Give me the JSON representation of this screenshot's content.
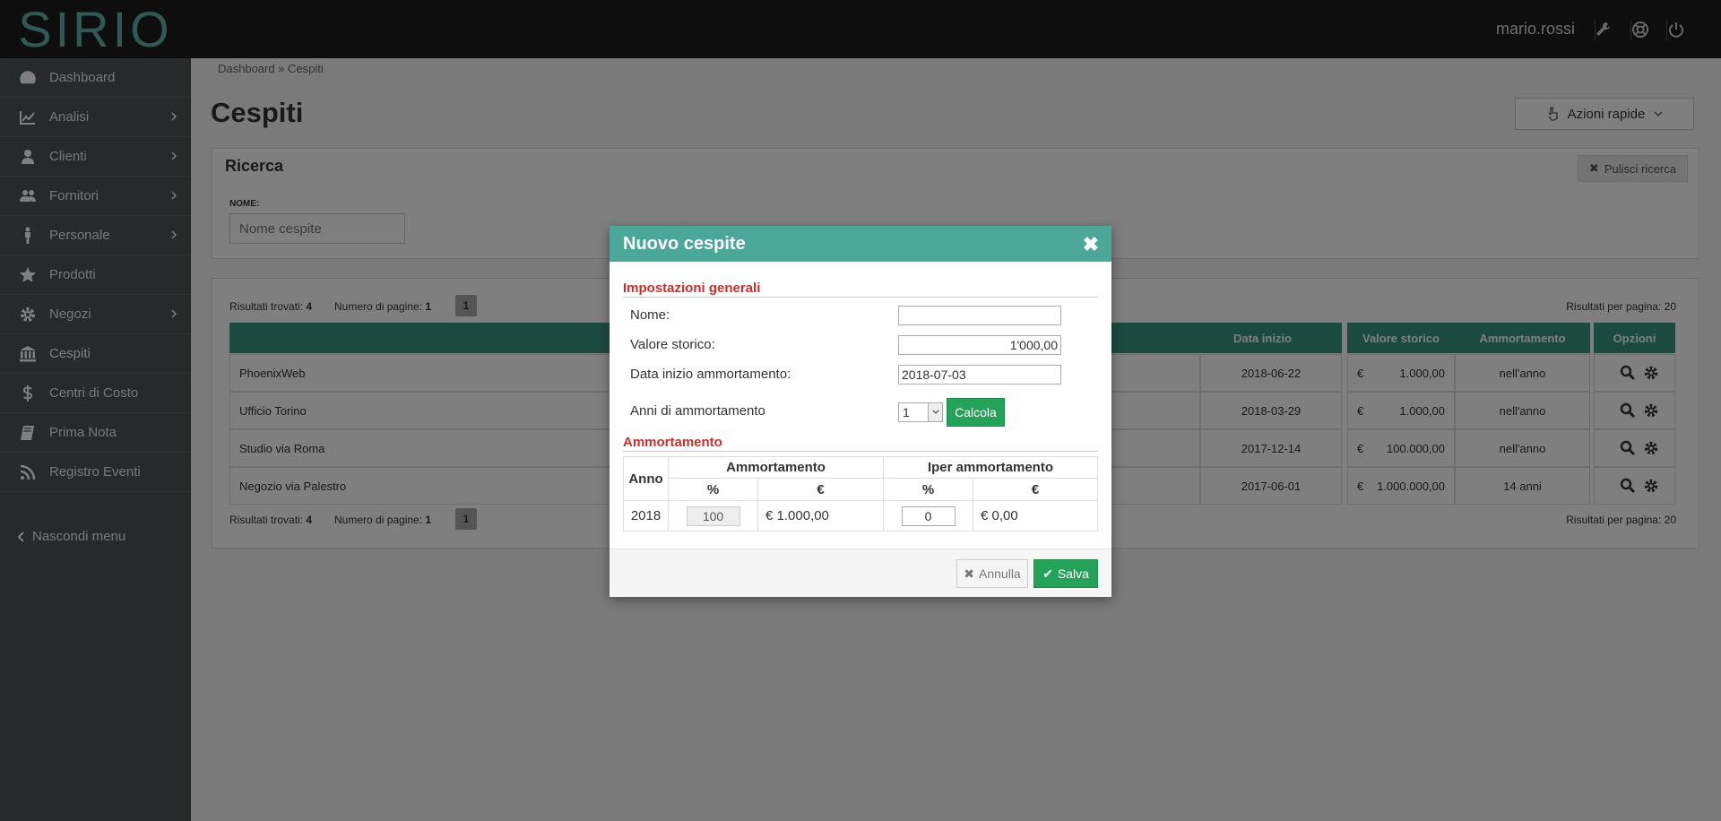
{
  "app": {
    "logo": "SIRIO",
    "user": "mario.rossi"
  },
  "sidebar": {
    "items": [
      {
        "label": "Dashboard",
        "icon": "dashboard-icon",
        "has_submenu": false
      },
      {
        "label": "Analisi",
        "icon": "chart-line-icon",
        "has_submenu": true
      },
      {
        "label": "Clienti",
        "icon": "user-icon",
        "has_submenu": true
      },
      {
        "label": "Fornitori",
        "icon": "users-icon",
        "has_submenu": true
      },
      {
        "label": "Personale",
        "icon": "male-icon",
        "has_submenu": true
      },
      {
        "label": "Prodotti",
        "icon": "star-icon",
        "has_submenu": false
      },
      {
        "label": "Negozi",
        "icon": "gear-icon",
        "has_submenu": true
      },
      {
        "label": "Cespiti",
        "icon": "bank-icon",
        "has_submenu": false,
        "active": true
      },
      {
        "label": "Centri di Costo",
        "icon": "dollar-icon",
        "has_submenu": false
      },
      {
        "label": "Prima Nota",
        "icon": "book-icon",
        "has_submenu": false
      },
      {
        "label": "Registro Eventi",
        "icon": "rss-icon",
        "has_submenu": false
      }
    ],
    "hide_menu": "Nascondi menu"
  },
  "topbar": {
    "icons": [
      "wrench-icon",
      "lifebuoy-icon",
      "power-icon"
    ]
  },
  "breadcrumb": "Dashboard » Cespiti",
  "page": {
    "title": "Cespiti",
    "quick_actions": "Azioni rapide"
  },
  "search": {
    "title": "Ricerca",
    "clear": "Pulisci ricerca",
    "name_label": "NOME:",
    "name_placeholder": "Nome cespite"
  },
  "results": {
    "found_label": "Risultati trovati:",
    "found": "4",
    "pages_label": "Numero di pagine:",
    "pages": "1",
    "current_page": "1",
    "per_page": "Risultati per pagina: 20"
  },
  "table": {
    "headers": {
      "start": "Data inizio",
      "value": "Valore storico",
      "amort": "Ammortamento",
      "options": "Opzioni"
    },
    "rows": [
      {
        "name": "PhoenixWeb",
        "start": "2018-06-22",
        "currency": "€",
        "value": "1.000,00",
        "amort": "nell'anno"
      },
      {
        "name": "Ufficio Torino",
        "start": "2018-03-29",
        "currency": "€",
        "value": "1.000,00",
        "amort": "nell'anno"
      },
      {
        "name": "Studio via Roma",
        "start": "2017-12-14",
        "currency": "€",
        "value": "100.000,00",
        "amort": "nell'anno"
      },
      {
        "name": "Negozio via Palestro",
        "start": "2017-06-01",
        "currency": "€",
        "value": "1.000.000,00",
        "amort": "14 anni"
      }
    ]
  },
  "modal": {
    "title": "Nuovo cespite",
    "section_general": "Impostazioni generali",
    "name_label": "Nome:",
    "name_value": "",
    "value_label": "Valore storico:",
    "value_value": "1'000,00",
    "date_label": "Data inizio ammortamento:",
    "date_value": "2018-07-03",
    "years_label": "Anni di ammortamento",
    "years_value": "1",
    "calc_button": "Calcola",
    "section_amort": "Ammortamento",
    "amort_table": {
      "col_year": "Anno",
      "group1": "Ammortamento",
      "group2": "Iper ammortamento",
      "pct": "%",
      "eur": "€",
      "row": {
        "year": "2018",
        "pct1": "100",
        "eur1": "€ 1.000,00",
        "pct2": "0",
        "eur2": "€ 0,00"
      }
    },
    "cancel": "Annulla",
    "save": "Salva"
  }
}
